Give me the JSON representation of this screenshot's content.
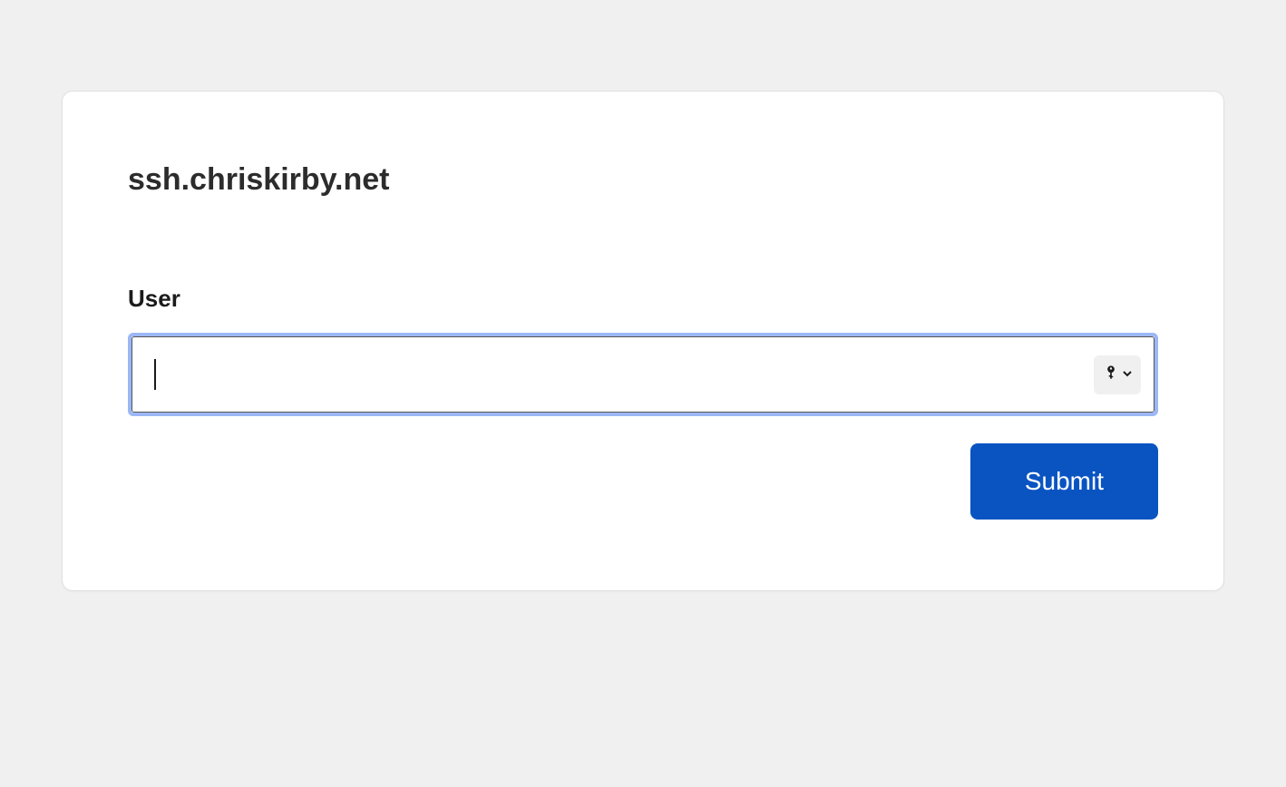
{
  "title": "ssh.chriskirby.net",
  "form": {
    "user_label": "User",
    "user_value": "",
    "submit_label": "Submit"
  }
}
